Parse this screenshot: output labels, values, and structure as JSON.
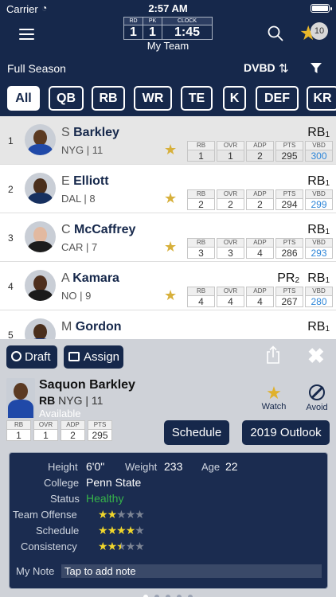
{
  "status_bar": {
    "carrier": "Carrier",
    "time": "2:57 AM",
    "battery_level": 1.0
  },
  "header": {
    "clock": {
      "rd_label": "RD",
      "rd_value": "1",
      "pk_label": "PK",
      "pk_value": "1",
      "clock_label": "CLOCK",
      "clock_value": "1:45"
    },
    "team_label": "My Team",
    "watchlist_count": "10"
  },
  "toolbar": {
    "season": "Full Season",
    "sort_label": "DVBD",
    "sort_icon": "sort-desc-icon",
    "filter_icon": "funnel-icon"
  },
  "positions": [
    "All",
    "QB",
    "RB",
    "WR",
    "TE",
    "K",
    "DEF",
    "KR"
  ],
  "active_position": "All",
  "stat_labels": [
    "RB",
    "OVR",
    "ADP",
    "PTS",
    "VBD"
  ],
  "players": [
    {
      "num": "1",
      "initial": "S",
      "last": "Barkley",
      "team": "NYG | 11",
      "rank_pos": "RB",
      "rank_num": "1",
      "pr": "",
      "stats": [
        "1",
        "1",
        "2",
        "295",
        "300"
      ],
      "skin": "#5b3a22",
      "jersey": "#2049a8"
    },
    {
      "num": "2",
      "initial": "E",
      "last": "Elliott",
      "team": "DAL | 8",
      "rank_pos": "RB",
      "rank_num": "1",
      "pr": "",
      "stats": [
        "2",
        "2",
        "2",
        "294",
        "299"
      ],
      "skin": "#4a2f1c",
      "jersey": "#17305f"
    },
    {
      "num": "3",
      "initial": "C",
      "last": "McCaffrey",
      "team": "CAR | 7",
      "rank_pos": "RB",
      "rank_num": "1",
      "pr": "",
      "stats": [
        "3",
        "3",
        "4",
        "286",
        "293"
      ],
      "skin": "#e2b9a0",
      "jersey": "#1c1c1c"
    },
    {
      "num": "4",
      "initial": "A",
      "last": "Kamara",
      "team": "NO | 9",
      "rank_pos": "RB",
      "rank_num": "1",
      "pr": "PR",
      "pr_num": "2",
      "stats": [
        "4",
        "4",
        "4",
        "267",
        "280"
      ],
      "skin": "#4e2f1d",
      "jersey": "#1a1a1a"
    },
    {
      "num": "5",
      "initial": "M",
      "last": "Gordon",
      "team": "",
      "rank_pos": "RB",
      "rank_num": "1",
      "pr": "",
      "stats": [
        "",
        "",
        "",
        "",
        ""
      ],
      "skin": "#4a2f1c",
      "jersey": "#1f3e86"
    }
  ],
  "panel": {
    "draft_label": "Draft",
    "assign_label": "Assign",
    "player": {
      "first": "Saquon",
      "last": "Barkley",
      "full_name": "Saquon Barkley",
      "pos": "RB",
      "team": "NYG | 11",
      "status": "Available"
    },
    "watch_label": "Watch",
    "avoid_label": "Avoid",
    "stat_labels": [
      "RB",
      "OVR",
      "ADP",
      "PTS"
    ],
    "stat_values": [
      "1",
      "1",
      "2",
      "295"
    ],
    "schedule_label": "Schedule",
    "outlook_label": "2019 Outlook",
    "info": {
      "height_label": "Height",
      "height": "6'0\"",
      "weight_label": "Weight",
      "weight": "233",
      "age_label": "Age",
      "age": "22",
      "college_label": "College",
      "college": "Penn State",
      "status_label": "Status",
      "status": "Healthy",
      "team_offense_label": "Team Offense",
      "team_offense_rating": 2,
      "schedule_label": "Schedule",
      "schedule_rating": 4,
      "consistency_label": "Consistency",
      "consistency_rating": 2.5,
      "note_label": "My Note",
      "note_placeholder": "Tap to add note"
    }
  },
  "page_dots": {
    "count": 5,
    "active": 0
  },
  "colors": {
    "navy": "#16284b",
    "star_gold": "#e0b12c",
    "vbd_blue": "#2e86d8",
    "healthy_green": "#36b34a"
  }
}
